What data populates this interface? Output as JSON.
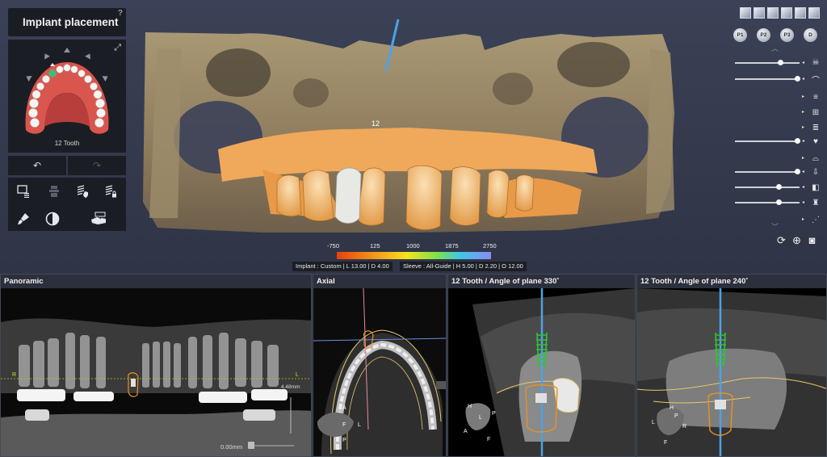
{
  "sidebar": {
    "title": "Implant placement",
    "help": "?",
    "selected_tooth_label": "12 Tooth",
    "tooth_number": "12"
  },
  "colorbar": {
    "ticks": [
      "-750",
      "125",
      "1000",
      "1875",
      "2750"
    ]
  },
  "info": {
    "implant": "Implant : Custom | L 13.00 | D 4.00",
    "sleeve": "Sleeve : All-Guide | H 5.00 | D 2.20 | O 12.00"
  },
  "presets": [
    "P1",
    "P2",
    "P3",
    "D"
  ],
  "panels": {
    "panoramic": "Panoramic",
    "axial": "Axial",
    "cross1": "12 Tooth / Angle of plane 330˚",
    "cross2": "12 Tooth / Angle of plane 240˚"
  },
  "panoramic": {
    "zoom_value": "0.00mm",
    "measure": "4.48mm",
    "left_marker": "R",
    "right_marker": "L"
  },
  "orientation": {
    "axial": [
      "A",
      "F",
      "L",
      "P"
    ],
    "cross1": [
      "H",
      "P",
      "L",
      "A",
      "F"
    ],
    "cross2": [
      "H",
      "P",
      "L",
      "R",
      "F"
    ]
  },
  "colors": {
    "implant_green": "#2ec43a",
    "sleeve_orange": "#e8921e",
    "axis_blue": "#4aa3e8",
    "model_orange": "#f0a85a"
  }
}
